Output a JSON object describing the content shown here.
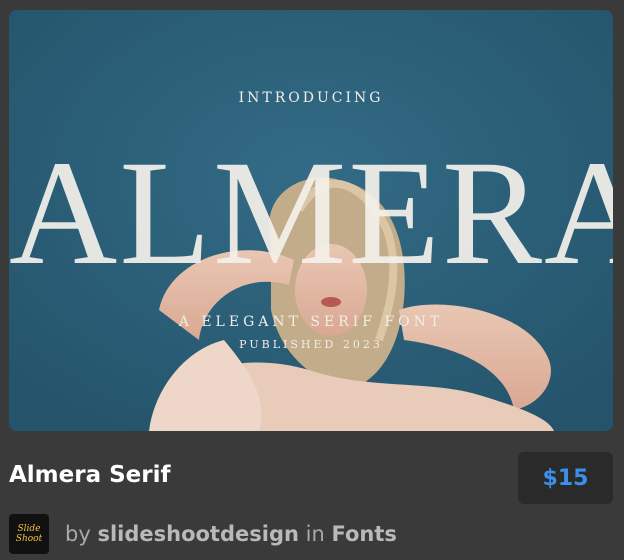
{
  "preview": {
    "intro": "INTRODUCING",
    "big_word": "ALMERA",
    "tagline": "A ELEGANT SERIF FONT",
    "published": "PUBLISHED 2023"
  },
  "item": {
    "title": "Almera Serif",
    "price": "$15"
  },
  "author": {
    "avatar_line1": "Slide",
    "avatar_line2": "Shoot",
    "by": "by",
    "name": "slideshootdesign",
    "in": "in",
    "category": "Fonts"
  },
  "colors": {
    "background": "#3a3a3a",
    "sky": "#2b5d76",
    "price": "#3d8ee8",
    "price_box": "#2a2a2a"
  }
}
